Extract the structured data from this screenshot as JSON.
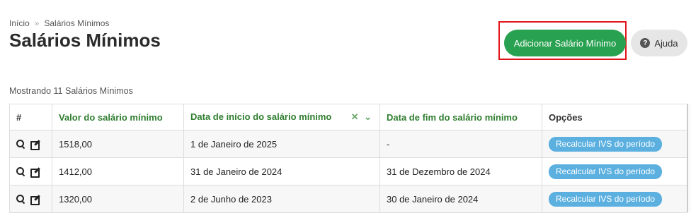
{
  "breadcrumb": {
    "home": "Início",
    "separator": "»",
    "current": "Salários Mínimos"
  },
  "header": {
    "title": "Salários Mínimos",
    "add_button": "Adicionar Salário Mínimo",
    "help_button": "Ajuda",
    "help_icon": "?"
  },
  "summary": {
    "count_text": "Mostrando 11 Salários Mínimos"
  },
  "table": {
    "columns": {
      "hash": "#",
      "value": "Valor do salário mínimo",
      "start": "Data de início do salário mínimo",
      "end": "Data de fim do salário mínimo",
      "options": "Opções"
    },
    "sort_icons": "✕ ⌄",
    "rows": [
      {
        "value": "1518,00",
        "start": "1 de Janeiro de 2025",
        "end": "-",
        "action": "Recalcular IVS do período"
      },
      {
        "value": "1412,00",
        "start": "31 de Janeiro de 2024",
        "end": "31 de Dezembro de 2024",
        "action": "Recalcular IVS do período"
      },
      {
        "value": "1320,00",
        "start": "2 de Junho de 2023",
        "end": "30 de Janeiro de 2024",
        "action": "Recalcular IVS do período"
      }
    ]
  },
  "colors": {
    "primary_green": "#28a150",
    "header_green": "#2f7d2f",
    "action_blue": "#5bb0e0",
    "highlight_red": "#e0161b"
  }
}
